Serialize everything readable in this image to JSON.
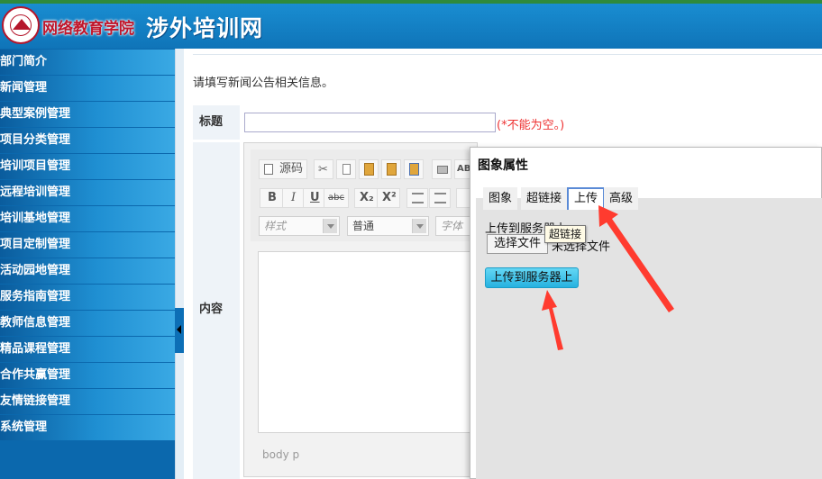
{
  "header": {
    "site_name": "网络教育学院",
    "slogan": "涉外培训网"
  },
  "sidebar": {
    "items": [
      {
        "label": "部门简介"
      },
      {
        "label": "新闻管理"
      },
      {
        "label": "典型案例管理"
      },
      {
        "label": "项目分类管理"
      },
      {
        "label": "培训项目管理"
      },
      {
        "label": "远程培训管理"
      },
      {
        "label": "培训基地管理"
      },
      {
        "label": "项目定制管理"
      },
      {
        "label": "活动园地管理"
      },
      {
        "label": "服务指南管理"
      },
      {
        "label": "教师信息管理"
      },
      {
        "label": "精品课程管理"
      },
      {
        "label": "合作共赢管理"
      },
      {
        "label": "友情链接管理"
      },
      {
        "label": "系统管理"
      }
    ]
  },
  "main": {
    "intro": "请填写新闻公告相关信息。",
    "title_label": "标题",
    "title_value": "",
    "title_hint": "(*不能为空。)",
    "content_label": "内容"
  },
  "editor": {
    "source_label": "源码",
    "bold": "B",
    "italic": "I",
    "underline": "U",
    "strike": "abc",
    "subscript": "X₂",
    "superscript": "X²",
    "style_select": "样式",
    "format_select": "普通",
    "font_select": "字体",
    "path": "body  p"
  },
  "dialog": {
    "title": "图象属性",
    "tabs": [
      {
        "label": "图象"
      },
      {
        "label": "超链接"
      },
      {
        "label": "上传"
      },
      {
        "label": "高级"
      }
    ],
    "upload_label": "上传到服务器上",
    "choose_file": "选择文件",
    "no_file": "未选择文件",
    "tooltip": "超链接",
    "upload_button": "上传到服务器上"
  },
  "colors": {
    "header_blue": "#1582c8",
    "sidebar_blue": "#0b68ad",
    "hint_red": "#e33333",
    "annotation_red": "#ff3b2f",
    "upload_button": "#35c0ea"
  }
}
